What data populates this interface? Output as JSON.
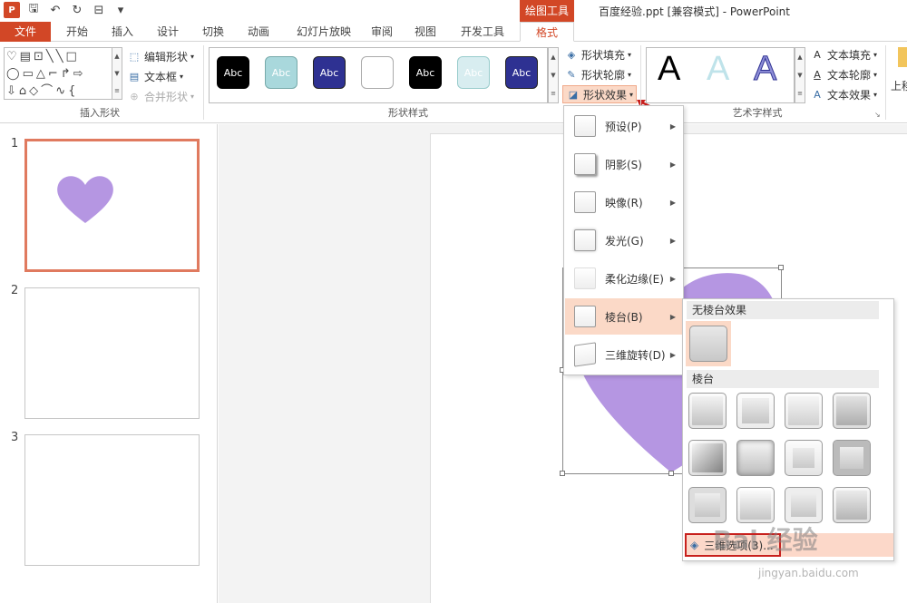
{
  "app": {
    "title": "百度经验.ppt [兼容模式] - PowerPoint",
    "context_tab_title": "绘图工具",
    "logo_letter": "P"
  },
  "tabs": [
    "文件",
    "开始",
    "插入",
    "设计",
    "切换",
    "动画",
    "幻灯片放映",
    "审阅",
    "视图",
    "开发工具",
    "格式"
  ],
  "ribbon": {
    "insert_shapes": {
      "label": "插入形状",
      "edit_shape": "编辑形状",
      "text_box": "文本框",
      "merge_shapes": "合并形状",
      "shape_glyphs": [
        [
          "♡",
          "▤",
          "⊡",
          "╲",
          "╲",
          "□"
        ],
        [
          "◯",
          "▭",
          "△",
          "⌐",
          "↱",
          "⇨"
        ],
        [
          "⇩",
          "⌂",
          "◇",
          "⌒",
          "∿",
          "{"
        ]
      ]
    },
    "shape_styles": {
      "label": "形状样式",
      "sample_text": "Abc",
      "shape_fill": "形状填充",
      "shape_outline": "形状轮廓",
      "shape_effects": "形状效果"
    },
    "wordart": {
      "label": "艺术字样式",
      "text_fill": "文本填充",
      "text_outline": "文本轮廓",
      "text_effects": "文本效果",
      "sample_letter": "A"
    },
    "extra_label": "上移"
  },
  "slides": [
    {
      "number": "1"
    },
    {
      "number": "2"
    },
    {
      "number": "3"
    }
  ],
  "effects_menu": {
    "items": [
      {
        "label": "预设(P)"
      },
      {
        "label": "阴影(S)"
      },
      {
        "label": "映像(R)"
      },
      {
        "label": "发光(G)"
      },
      {
        "label": "柔化边缘(E)"
      },
      {
        "label": "棱台(B)"
      },
      {
        "label": "三维旋转(D)"
      }
    ]
  },
  "bevel_menu": {
    "no_bevel": "无棱台效果",
    "bevel": "棱台",
    "footer": "三维选项(3)..."
  },
  "watermark": {
    "text": "Bai 经验",
    "url": "jingyan.baidu.com"
  },
  "colors": {
    "accent": "#d24726",
    "heart": "#b596e2",
    "hover": "#fbd9c7",
    "red_marker": "#c8201d"
  }
}
